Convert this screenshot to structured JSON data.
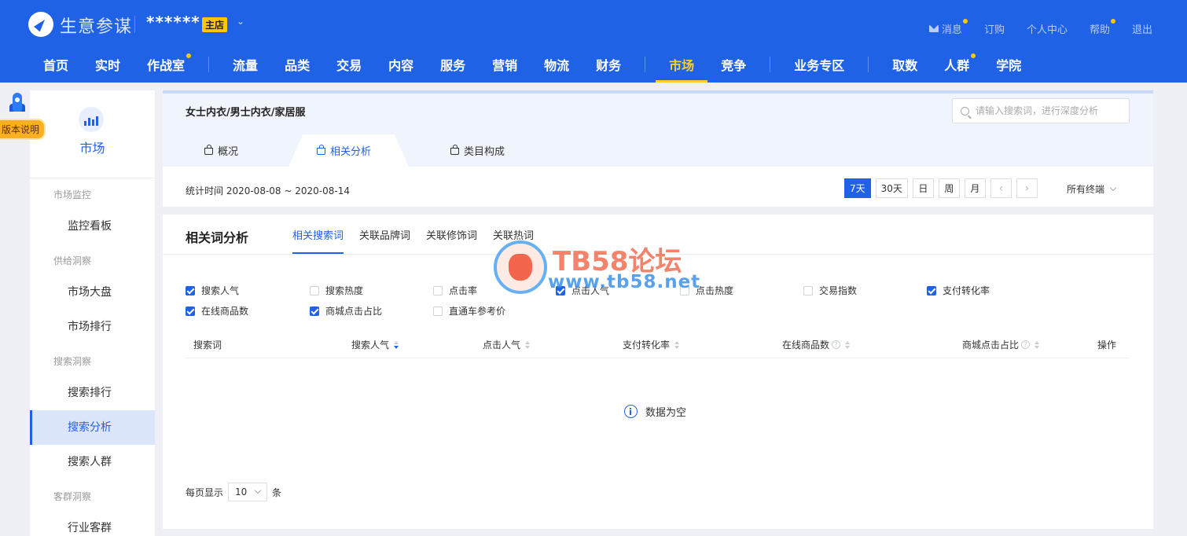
{
  "header": {
    "brand": "生意参谋",
    "shop_name": "******",
    "shop_badge": "主店",
    "top_links": [
      {
        "label": "消息",
        "dot": true
      },
      {
        "label": "订购",
        "dot": false
      },
      {
        "label": "个人中心",
        "dot": false
      },
      {
        "label": "帮助",
        "dot": true
      },
      {
        "label": "退出",
        "dot": false
      }
    ],
    "nav": [
      "首页",
      "实时",
      "作战室",
      "流量",
      "品类",
      "交易",
      "内容",
      "服务",
      "营销",
      "物流",
      "财务",
      "市场",
      "竞争",
      "业务专区",
      "取数",
      "人群",
      "学院"
    ],
    "nav_active": "市场",
    "accent_color": "#2062e6",
    "highlight_color": "#ffcd2e"
  },
  "floating": {
    "version_label": "版本说明"
  },
  "sidebar": {
    "title": "市场",
    "groups": [
      {
        "label": "市场监控",
        "items": [
          "监控看板"
        ]
      },
      {
        "label": "供给洞察",
        "items": [
          "市场大盘",
          "市场排行"
        ]
      },
      {
        "label": "搜索洞察",
        "items": [
          "搜索排行",
          "搜索分析",
          "搜索人群"
        ]
      },
      {
        "label": "客群洞察",
        "items": [
          "行业客群"
        ]
      }
    ],
    "active_item": "搜索分析"
  },
  "topcard": {
    "category": "女士内衣/男士内衣/家居服",
    "search_placeholder": "请输入搜索词，进行深度分析",
    "tabs": [
      "概况",
      "相关分析",
      "类目构成"
    ],
    "active_tab": "相关分析",
    "stat_time": "统计时间 2020-08-08 ~ 2020-08-14",
    "periods": [
      "7天",
      "30天",
      "日",
      "周",
      "月"
    ],
    "active_period": "7天",
    "prev_arrow": "‹",
    "next_arrow": "›",
    "device": "所有终端"
  },
  "main": {
    "title": "相关词分析",
    "sub_tabs": [
      "相关搜索词",
      "关联品牌词",
      "关联修饰词",
      "关联热词"
    ],
    "active_sub_tab": "相关搜索词",
    "metrics": [
      {
        "label": "搜索人气",
        "checked": true
      },
      {
        "label": "搜索热度",
        "checked": false
      },
      {
        "label": "点击率",
        "checked": false
      },
      {
        "label": "点击人气",
        "checked": true
      },
      {
        "label": "点击热度",
        "checked": false
      },
      {
        "label": "交易指数",
        "checked": false
      },
      {
        "label": "支付转化率",
        "checked": true
      },
      {
        "label": "在线商品数",
        "checked": true
      },
      {
        "label": "商城点击占比",
        "checked": true
      },
      {
        "label": "直通车参考价",
        "checked": false
      }
    ],
    "columns": [
      "搜索词",
      "搜索人气",
      "点击人气",
      "支付转化率",
      "在线商品数",
      "商城点击占比",
      "操作"
    ],
    "empty_text": "数据为空",
    "pager": {
      "prefix": "每页显示",
      "size": "10",
      "suffix": "条"
    }
  },
  "watermark": {
    "line1": "TB58论坛",
    "line2": "www.tb58.net"
  }
}
